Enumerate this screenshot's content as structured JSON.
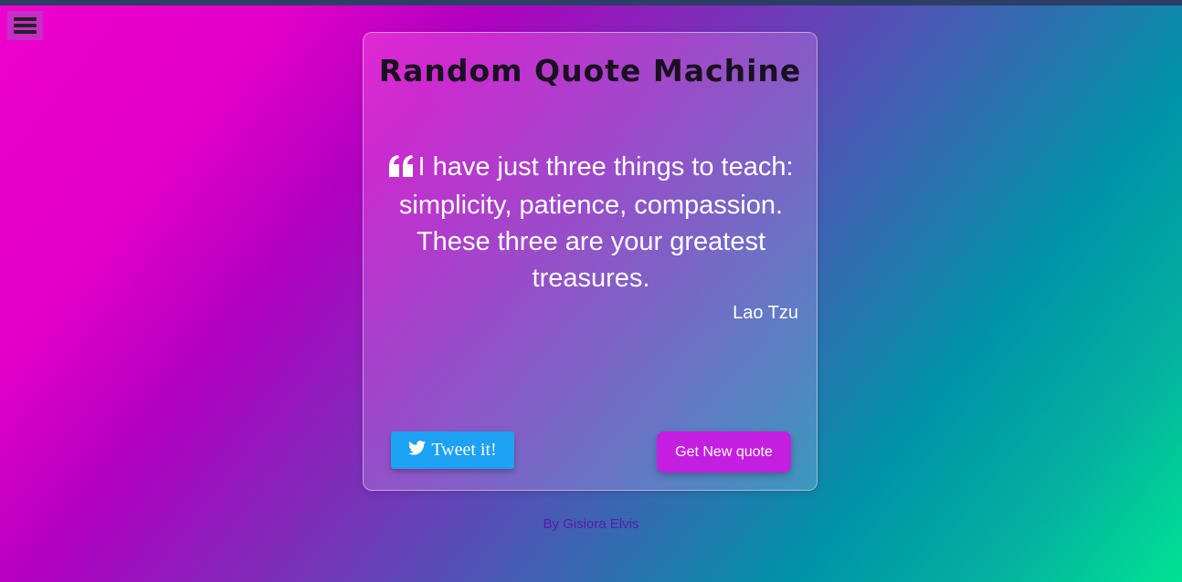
{
  "header": {
    "menu_icon": "hamburger-menu-icon"
  },
  "card": {
    "title": "Random Quote Machine",
    "quote_icon": "quote-left-icon",
    "quote_text": "I have just three things to teach: simplicity, patience, compassion. These three are your greatest treasures.",
    "author": "Lao Tzu",
    "tweet_button": {
      "icon": "twitter-icon",
      "label": "Tweet it!"
    },
    "new_quote_button": {
      "label": "Get New quote"
    }
  },
  "footer": {
    "credit": "By Gisiora Elvis"
  },
  "colors": {
    "tweet_button": "#1da1f2",
    "new_quote_button": "#c41ee0",
    "footer_text": "#5a1aa8",
    "top_bar": "#2c3e66"
  }
}
